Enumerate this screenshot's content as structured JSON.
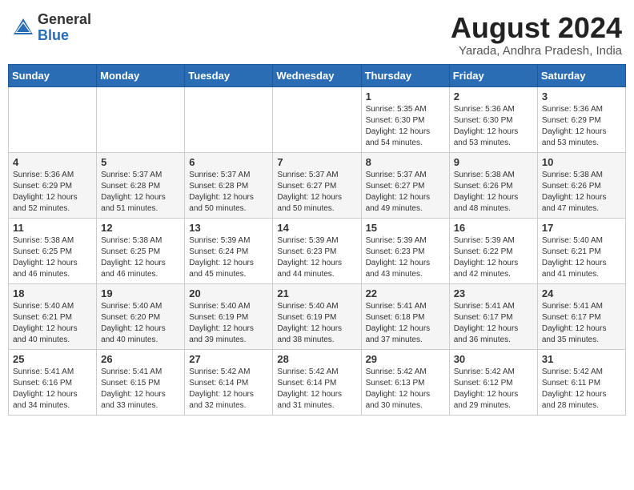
{
  "logo": {
    "general": "General",
    "blue": "Blue"
  },
  "title": "August 2024",
  "location": "Yarada, Andhra Pradesh, India",
  "days_of_week": [
    "Sunday",
    "Monday",
    "Tuesday",
    "Wednesday",
    "Thursday",
    "Friday",
    "Saturday"
  ],
  "weeks": [
    [
      {
        "day": "",
        "info": ""
      },
      {
        "day": "",
        "info": ""
      },
      {
        "day": "",
        "info": ""
      },
      {
        "day": "",
        "info": ""
      },
      {
        "day": "1",
        "info": "Sunrise: 5:35 AM\nSunset: 6:30 PM\nDaylight: 12 hours\nand 54 minutes."
      },
      {
        "day": "2",
        "info": "Sunrise: 5:36 AM\nSunset: 6:30 PM\nDaylight: 12 hours\nand 53 minutes."
      },
      {
        "day": "3",
        "info": "Sunrise: 5:36 AM\nSunset: 6:29 PM\nDaylight: 12 hours\nand 53 minutes."
      }
    ],
    [
      {
        "day": "4",
        "info": "Sunrise: 5:36 AM\nSunset: 6:29 PM\nDaylight: 12 hours\nand 52 minutes."
      },
      {
        "day": "5",
        "info": "Sunrise: 5:37 AM\nSunset: 6:28 PM\nDaylight: 12 hours\nand 51 minutes."
      },
      {
        "day": "6",
        "info": "Sunrise: 5:37 AM\nSunset: 6:28 PM\nDaylight: 12 hours\nand 50 minutes."
      },
      {
        "day": "7",
        "info": "Sunrise: 5:37 AM\nSunset: 6:27 PM\nDaylight: 12 hours\nand 50 minutes."
      },
      {
        "day": "8",
        "info": "Sunrise: 5:37 AM\nSunset: 6:27 PM\nDaylight: 12 hours\nand 49 minutes."
      },
      {
        "day": "9",
        "info": "Sunrise: 5:38 AM\nSunset: 6:26 PM\nDaylight: 12 hours\nand 48 minutes."
      },
      {
        "day": "10",
        "info": "Sunrise: 5:38 AM\nSunset: 6:26 PM\nDaylight: 12 hours\nand 47 minutes."
      }
    ],
    [
      {
        "day": "11",
        "info": "Sunrise: 5:38 AM\nSunset: 6:25 PM\nDaylight: 12 hours\nand 46 minutes."
      },
      {
        "day": "12",
        "info": "Sunrise: 5:38 AM\nSunset: 6:25 PM\nDaylight: 12 hours\nand 46 minutes."
      },
      {
        "day": "13",
        "info": "Sunrise: 5:39 AM\nSunset: 6:24 PM\nDaylight: 12 hours\nand 45 minutes."
      },
      {
        "day": "14",
        "info": "Sunrise: 5:39 AM\nSunset: 6:23 PM\nDaylight: 12 hours\nand 44 minutes."
      },
      {
        "day": "15",
        "info": "Sunrise: 5:39 AM\nSunset: 6:23 PM\nDaylight: 12 hours\nand 43 minutes."
      },
      {
        "day": "16",
        "info": "Sunrise: 5:39 AM\nSunset: 6:22 PM\nDaylight: 12 hours\nand 42 minutes."
      },
      {
        "day": "17",
        "info": "Sunrise: 5:40 AM\nSunset: 6:21 PM\nDaylight: 12 hours\nand 41 minutes."
      }
    ],
    [
      {
        "day": "18",
        "info": "Sunrise: 5:40 AM\nSunset: 6:21 PM\nDaylight: 12 hours\nand 40 minutes."
      },
      {
        "day": "19",
        "info": "Sunrise: 5:40 AM\nSunset: 6:20 PM\nDaylight: 12 hours\nand 40 minutes."
      },
      {
        "day": "20",
        "info": "Sunrise: 5:40 AM\nSunset: 6:19 PM\nDaylight: 12 hours\nand 39 minutes."
      },
      {
        "day": "21",
        "info": "Sunrise: 5:40 AM\nSunset: 6:19 PM\nDaylight: 12 hours\nand 38 minutes."
      },
      {
        "day": "22",
        "info": "Sunrise: 5:41 AM\nSunset: 6:18 PM\nDaylight: 12 hours\nand 37 minutes."
      },
      {
        "day": "23",
        "info": "Sunrise: 5:41 AM\nSunset: 6:17 PM\nDaylight: 12 hours\nand 36 minutes."
      },
      {
        "day": "24",
        "info": "Sunrise: 5:41 AM\nSunset: 6:17 PM\nDaylight: 12 hours\nand 35 minutes."
      }
    ],
    [
      {
        "day": "25",
        "info": "Sunrise: 5:41 AM\nSunset: 6:16 PM\nDaylight: 12 hours\nand 34 minutes."
      },
      {
        "day": "26",
        "info": "Sunrise: 5:41 AM\nSunset: 6:15 PM\nDaylight: 12 hours\nand 33 minutes."
      },
      {
        "day": "27",
        "info": "Sunrise: 5:42 AM\nSunset: 6:14 PM\nDaylight: 12 hours\nand 32 minutes."
      },
      {
        "day": "28",
        "info": "Sunrise: 5:42 AM\nSunset: 6:14 PM\nDaylight: 12 hours\nand 31 minutes."
      },
      {
        "day": "29",
        "info": "Sunrise: 5:42 AM\nSunset: 6:13 PM\nDaylight: 12 hours\nand 30 minutes."
      },
      {
        "day": "30",
        "info": "Sunrise: 5:42 AM\nSunset: 6:12 PM\nDaylight: 12 hours\nand 29 minutes."
      },
      {
        "day": "31",
        "info": "Sunrise: 5:42 AM\nSunset: 6:11 PM\nDaylight: 12 hours\nand 28 minutes."
      }
    ]
  ]
}
